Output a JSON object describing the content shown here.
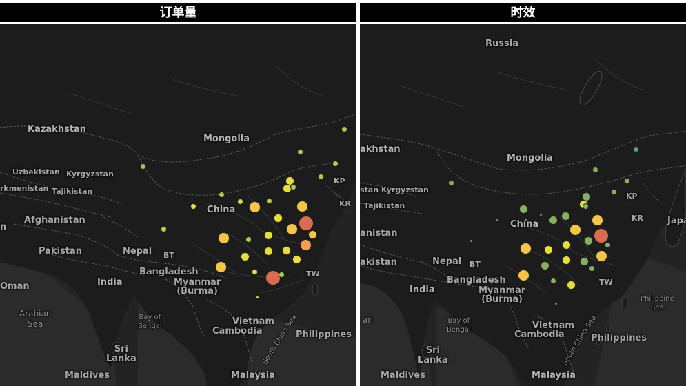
{
  "panels": [
    {
      "title": "订单量",
      "labels": {
        "kazakhstan": "Kazakhstan",
        "mongolia": "Mongolia",
        "uzbekistan": "Uzbekistan",
        "kyrgyzstan": "Kyrgyzstan",
        "turkmenistan": "rkmenistan",
        "tajikistan": "Tajikistan",
        "china": "China",
        "kp": "KP",
        "kr": "KR",
        "afghanistan": "Afghanistan",
        "n_edge": "n",
        "pakistan": "Pakistan",
        "nepal": "Nepal",
        "bt": "BT",
        "bangladesh": "Bangladesh",
        "india": "India",
        "myanmar": "Myanmar\n(Burma)",
        "oman": "Oman",
        "tw": "TW",
        "arabian_sea": "Arabian\nSea",
        "bay_of_bengal": "Bay of\nBengal",
        "vietnam": "Vietnam",
        "cambodia": "Cambodia",
        "south_china_sea": "South China Sea",
        "philippines": "Philippines",
        "sri_lanka": "Sri\nLanka",
        "maldives": "Maldives",
        "malaysia": "Malaysia"
      },
      "markers": [
        {
          "color": "#a6c85a",
          "size": "small"
        },
        {
          "color": "#a6c85a",
          "size": "small"
        },
        {
          "color": "#a6c85a",
          "size": "small"
        },
        {
          "color": "#b8cc55",
          "size": "small"
        },
        {
          "color": "#e8dd40",
          "size": "medium"
        },
        {
          "color": "#e8dd40",
          "size": "medium"
        },
        {
          "color": "#a6c85a",
          "size": "small"
        },
        {
          "color": "#a6c85a",
          "size": "small"
        },
        {
          "color": "#a6c85a",
          "size": "small"
        },
        {
          "color": "#d4d650",
          "size": "small"
        },
        {
          "color": "#e8dd40",
          "size": "small"
        },
        {
          "color": "#b8cc55",
          "size": "small"
        },
        {
          "color": "#f4c548",
          "size": "large"
        },
        {
          "color": "#f4c548",
          "size": "large"
        },
        {
          "color": "#e8dd40",
          "size": "medium"
        },
        {
          "color": "#d86b52",
          "size": "xlarge"
        },
        {
          "color": "#f4c548",
          "size": "large"
        },
        {
          "color": "#f4c548",
          "size": "large"
        },
        {
          "color": "#f4c548",
          "size": "medium"
        },
        {
          "color": "#e8dd40",
          "size": "medium"
        },
        {
          "color": "#a6c85a",
          "size": "small"
        },
        {
          "color": "#e8dd40",
          "size": "medium"
        },
        {
          "color": "#f0a050",
          "size": "large"
        },
        {
          "color": "#e8dd40",
          "size": "medium"
        },
        {
          "color": "#e8dd40",
          "size": "medium"
        },
        {
          "color": "#e8dd40",
          "size": "medium"
        },
        {
          "color": "#f4c548",
          "size": "large"
        },
        {
          "color": "#e8dd40",
          "size": "small"
        },
        {
          "color": "#d86b52",
          "size": "xlarge"
        },
        {
          "color": "#b8cc55",
          "size": "small"
        },
        {
          "color": "#e8dd40",
          "size": "tiny"
        },
        {
          "color": "#a6c85a",
          "size": "small"
        }
      ]
    },
    {
      "title": "时效",
      "labels": {
        "russia": "Russia",
        "kazakhstan": "akhstan",
        "mongolia": "Mongolia",
        "kyrgyzstan": "stan Kyrgyzstan",
        "tajikistan": "Tajikistan",
        "china": "China",
        "kp": "KP",
        "kr": "KR",
        "japan": "Japa",
        "afghanistan": "anistan",
        "pakistan": "akistan",
        "nepal": "Nepal",
        "bt": "BT",
        "bangladesh": "Bangladesh",
        "india": "India",
        "myanmar": "Myanmar\n(Burma)",
        "an_edge": "an",
        "tw": "TW",
        "bay_of_bengal": "Bay of\nBengal",
        "vietnam": "Vietnam",
        "cambodia": "Cambodia",
        "south_china_sea": "South China Sea",
        "philippines": "Philippines",
        "philippine_sea": "Philippine\nSea",
        "sri_lanka": "Sri\nLanka",
        "maldives": "Maldives",
        "malaysia": "Malaysia"
      },
      "markers": [
        {
          "color": "#5aa07a",
          "size": "small"
        },
        {
          "color": "#86b060",
          "size": "small"
        },
        {
          "color": "#86b060",
          "size": "small"
        },
        {
          "color": "#86b060",
          "size": "small"
        },
        {
          "color": "#86b060",
          "size": "small"
        },
        {
          "color": "#86b060",
          "size": "medium"
        },
        {
          "color": "#86b060",
          "size": "medium"
        },
        {
          "color": "#e8dd40",
          "size": "medium"
        },
        {
          "color": "#5aa07a",
          "size": "tiny"
        },
        {
          "color": "#86b060",
          "size": "medium"
        },
        {
          "color": "#5aa07a",
          "size": "tiny"
        },
        {
          "color": "#5aa07a",
          "size": "tiny"
        },
        {
          "color": "#86b060",
          "size": "medium"
        },
        {
          "color": "#86b060",
          "size": "medium"
        },
        {
          "color": "#f4c548",
          "size": "large"
        },
        {
          "color": "#f4c548",
          "size": "large"
        },
        {
          "color": "#d86b52",
          "size": "xlarge"
        },
        {
          "color": "#e8dd40",
          "size": "medium"
        },
        {
          "color": "#86b060",
          "size": "medium"
        },
        {
          "color": "#f4c548",
          "size": "large"
        },
        {
          "color": "#e8dd40",
          "size": "medium"
        },
        {
          "color": "#86b060",
          "size": "small"
        },
        {
          "color": "#f4c548",
          "size": "large"
        },
        {
          "color": "#e8dd40",
          "size": "medium"
        },
        {
          "color": "#86b060",
          "size": "medium"
        },
        {
          "color": "#86b060",
          "size": "medium"
        },
        {
          "color": "#86b060",
          "size": "small"
        },
        {
          "color": "#f4c548",
          "size": "large"
        },
        {
          "color": "#86b060",
          "size": "small"
        },
        {
          "color": "#e8dd40",
          "size": "medium"
        },
        {
          "color": "#5aa07a",
          "size": "tiny"
        },
        {
          "color": "#5aa07a",
          "size": "tiny"
        },
        {
          "color": "#86b060",
          "size": "small"
        }
      ]
    }
  ]
}
